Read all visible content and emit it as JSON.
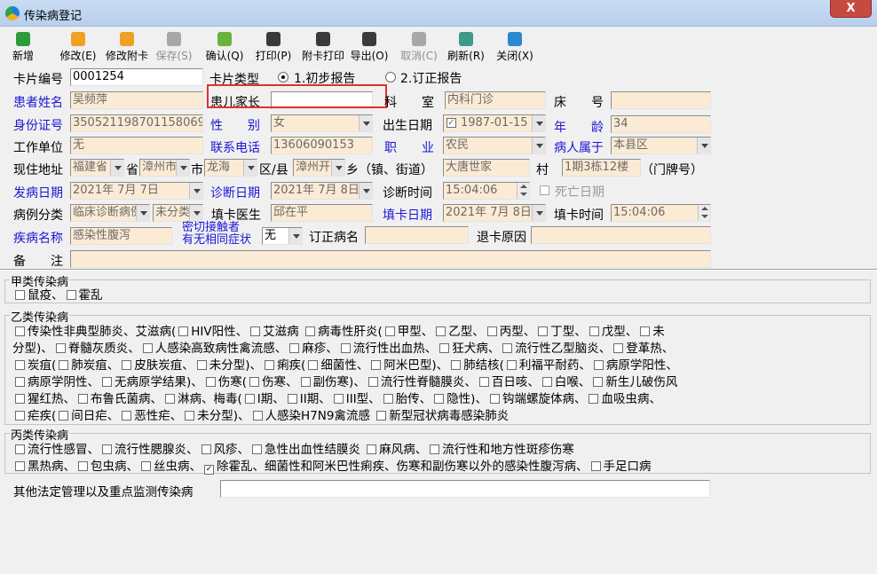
{
  "window": {
    "title": "传染病登记",
    "close_glyph": "X"
  },
  "toolbar": {
    "buttons": [
      {
        "label": "新增",
        "color": "#2e9b3a",
        "enabled": true
      },
      {
        "label": "修改(E)",
        "color": "#f0a024",
        "enabled": true
      },
      {
        "label": "修改附卡",
        "color": "#f0a024",
        "enabled": true
      },
      {
        "label": "保存(S)",
        "color": "#a8a8a8",
        "enabled": false
      },
      {
        "label": "确认(Q)",
        "color": "#6ab23a",
        "enabled": true
      },
      {
        "label": "打印(P)",
        "color": "#3a3a3a",
        "enabled": true
      },
      {
        "label": "附卡打印",
        "color": "#3a3a3a",
        "enabled": true
      },
      {
        "label": "导出(O)",
        "color": "#3a3a3a",
        "enabled": true
      },
      {
        "label": "取消(C)",
        "color": "#a8a8a8",
        "enabled": false
      },
      {
        "label": "刷新(R)",
        "color": "#3c9a8a",
        "enabled": true
      },
      {
        "label": "关闭(X)",
        "color": "#2a8ad0",
        "enabled": true
      }
    ]
  },
  "form": {
    "card_no": {
      "label": "卡片编号",
      "value": "0001254"
    },
    "card_type": {
      "label": "卡片类型",
      "options": [
        "1.初步报告",
        "2.订正报告"
      ],
      "selected": 0
    },
    "patient_name": {
      "label": "患者姓名",
      "value": "吴频萍"
    },
    "guardian": {
      "label": "患儿家长",
      "value": ""
    },
    "department": {
      "label": "科　　室",
      "value": "内科门诊"
    },
    "bed": {
      "label": "床　　号",
      "value": ""
    },
    "id_no": {
      "label": "身份证号",
      "value": "350521198701158069"
    },
    "sex": {
      "label": "性　　别",
      "value": "女"
    },
    "birth_date": {
      "label": "出生日期",
      "value": "1987-01-15",
      "checked": true
    },
    "age": {
      "label": "年　　龄",
      "value": "34"
    },
    "work_unit": {
      "label": "工作单位",
      "value": "无"
    },
    "phone": {
      "label": "联系电话",
      "value": "13606090153"
    },
    "occupation": {
      "label": "职　　业",
      "value": "农民"
    },
    "belongs": {
      "label": "病人属于",
      "value": "本县区"
    },
    "address": {
      "label": "现住地址",
      "province": "福建省",
      "province_unit": "省",
      "city": "漳州市",
      "city_unit": "市",
      "county": "龙海",
      "county_unit": "区/县",
      "town": "漳州开",
      "town_unit": "乡（镇、街道）",
      "village": "大唐世家",
      "village_unit": "村",
      "house": "1期3栋12楼",
      "house_unit": "（门牌号）"
    },
    "onset_date": {
      "label": "发病日期",
      "value": "2021年 7月 7日"
    },
    "diag_date": {
      "label": "诊断日期",
      "value": "2021年 7月 8日"
    },
    "diag_time": {
      "label": "诊断时间",
      "value": "15:04:06"
    },
    "death_date": {
      "label": "死亡日期",
      "checked": false
    },
    "case_class": {
      "label": "病例分类",
      "value": "临床诊断病例",
      "value2": "未分类"
    },
    "doctor": {
      "label": "填卡医生",
      "value": "邱在平"
    },
    "fill_date": {
      "label": "填卡日期",
      "value": "2021年 7月 8日"
    },
    "fill_time": {
      "label": "填卡时间",
      "value": "15:04:06"
    },
    "disease_name": {
      "label": "疾病名称",
      "value": "感染性腹泻"
    },
    "contact": {
      "label_line1": "密切接触者",
      "label_line2": "有无相同症状",
      "value": "无"
    },
    "corrected_name": {
      "label": "订正病名",
      "value": ""
    },
    "return_reason": {
      "label": "退卡原因",
      "value": ""
    },
    "remark": {
      "label": "备　　注",
      "value": ""
    }
  },
  "diseases": {
    "class_a": {
      "title": "甲类传染病",
      "lines": [
        "☐ 鼠疫、☐ 霍乱"
      ]
    },
    "class_b": {
      "title": "乙类传染病",
      "lines": [
        "☐ 传染性非典型肺炎、艾滋病(☐ HIV阳性、☐ 艾滋病 ☐ 病毒性肝炎(☐ 甲型、☐ 乙型、☐ 丙型、☐ 丁型、☐ 戊型、☐ 未",
        "分型)、☐ 脊髓灰质炎、☐ 人感染高致病性禽流感、☐ 麻疹、☐ 流行性出血热、☐ 狂犬病、☐ 流行性乙型脑炎、☐ 登革热、",
        "☐ 炭疽(☐ 肺炭疽、☐ 皮肤炭疽、☐ 未分型)、☐ 痢疾(☐ 细菌性、☐ 阿米巴型)、☐ 肺结核(☐ 利福平耐药、☐ 病原学阳性、",
        "☐ 病原学阴性、☐ 无病原学结果)、☐ 伤寒(☐ 伤寒、☐ 副伤寒)、☐ 流行性脊髓膜炎、☐ 百日咳、☐ 白喉、☐ 新生儿破伤风",
        "☐ 猩红热、☐ 布鲁氏菌病、☐ 淋病、梅毒(☐ I期、☐ II期、☐ III型、☐ 胎传、☐ 隐性)、☐ 钩端螺旋体病、☐ 血吸虫病、",
        "☐ 疟疾(☐ 间日疟、☐ 恶性疟、☐ 未分型)、☐ 人感染H7N9禽流感 ☐ 新型冠状病毒感染肺炎"
      ]
    },
    "class_c": {
      "title": "丙类传染病",
      "lines": [
        "☐ 流行性感冒、☐ 流行性腮腺炎、☐ 风疹、☐ 急性出血性结膜炎 ☐ 麻风病、☐ 流行性和地方性斑疹伤寒",
        "☐ 黑热病、☐ 包虫病、☐ 丝虫病、☑ 除霍乱、细菌性和阿米巴性痢疾、伤寒和副伤寒以外的感染性腹泻病、☐ 手足口病"
      ]
    },
    "other": {
      "label": "其他法定管理以及重点监测传染病",
      "value": ""
    }
  },
  "colors": {
    "label_blue": "#1b16d4",
    "field_pink": "#fcebd4",
    "highlight_red": "#e0302c"
  }
}
